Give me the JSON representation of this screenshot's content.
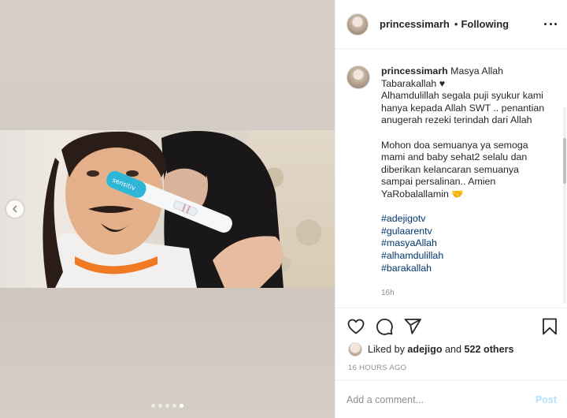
{
  "post": {
    "username": "princessimarh",
    "separator": "•",
    "follow_status": "Following",
    "avatar_icon": "profile-photo",
    "more_icon": "more-horizontal-icon"
  },
  "caption": {
    "username": "princessimarh",
    "lines": [
      "Masya Allah",
      "Tabarakallah ♥",
      "Alhamdulillah segala puji syukur kami",
      "hanya kepada Allah SWT .. penantian",
      "anugerah rezeki terindah dari Allah",
      "",
      "Mohon doa semuanya ya semoga",
      "mami and baby sehat2 selalu dan",
      "diberikan kelancaran semuanya",
      "sampai persalinan.. Amien",
      "YaRobalallamin 🤝"
    ],
    "hashtags": [
      "#adejigotv",
      "#gulaarentv",
      "#masyaAllah",
      "#alhamdulillah",
      "#barakallah"
    ],
    "time": "16h"
  },
  "media": {
    "carousel_dots": 5,
    "active_dot": 4,
    "prev_icon": "chevron-left-icon",
    "test_label": "sensitiv"
  },
  "actions": {
    "like_icon": "heart-icon",
    "comment_icon": "comment-icon",
    "share_icon": "share-icon",
    "save_icon": "bookmark-icon"
  },
  "likes": {
    "prefix": "Liked by",
    "user": "adejigo",
    "conj": "and",
    "others": "522 others"
  },
  "timestamp": "16 HOURS AGO",
  "comment": {
    "placeholder": "Add a comment...",
    "post_label": "Post"
  },
  "colors": {
    "link": "#00376b",
    "post_disabled": "#b2dffc",
    "muted": "#8e8e8e"
  }
}
